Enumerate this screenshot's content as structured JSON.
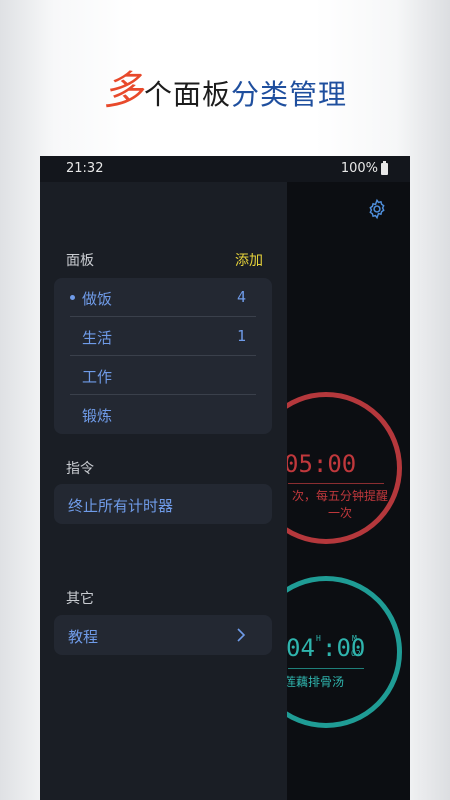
{
  "headline": {
    "accent": "多",
    "part1": "个面板",
    "part2": "分类管理"
  },
  "status": {
    "time": "21:32",
    "battery": "100%"
  },
  "drawer": {
    "panels_title": "面板",
    "add_label": "添加",
    "panels": [
      {
        "name": "做饭",
        "count": "4",
        "active": true
      },
      {
        "name": "生活",
        "count": "1",
        "active": false
      },
      {
        "name": "工作",
        "count": "",
        "active": false
      },
      {
        "name": "锻炼",
        "count": "",
        "active": false
      }
    ],
    "commands_title": "指令",
    "stop_all_label": "终止所有计时器",
    "other_title": "其它",
    "tutorial_label": "教程"
  },
  "main": {
    "timer1": {
      "time": "05:00",
      "note_line1": "次，每五分钟提醒",
      "note_line2": "一次"
    },
    "timer2": {
      "time": "04",
      "unit_h": "H",
      "time_min": ":00",
      "unit_m": "M",
      "unit_sub": "02",
      "note": "莲藕排骨汤"
    }
  },
  "colors": {
    "accent_red": "#e8492b",
    "accent_blue": "#1f4f9e",
    "link_blue": "#6f9be8",
    "add_yellow": "#e6d33a",
    "timer_red": "#c0383c",
    "timer_teal": "#2fb4ad"
  }
}
